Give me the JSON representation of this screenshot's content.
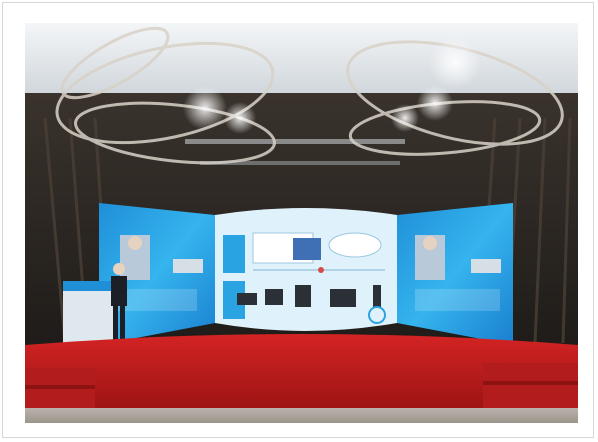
{
  "scene": {
    "subject": "conference-stage-with-led-screens",
    "colors": {
      "ceiling": "#e9eef2",
      "screen_blue": "#27a6e6",
      "screen_light": "#dff2fb",
      "stage_red": "#c81e1e",
      "wall_dark": "#2a2a2a"
    },
    "screens": [
      {
        "name": "left-side-screen"
      },
      {
        "name": "center-main-screen"
      },
      {
        "name": "right-side-screen"
      }
    ]
  }
}
